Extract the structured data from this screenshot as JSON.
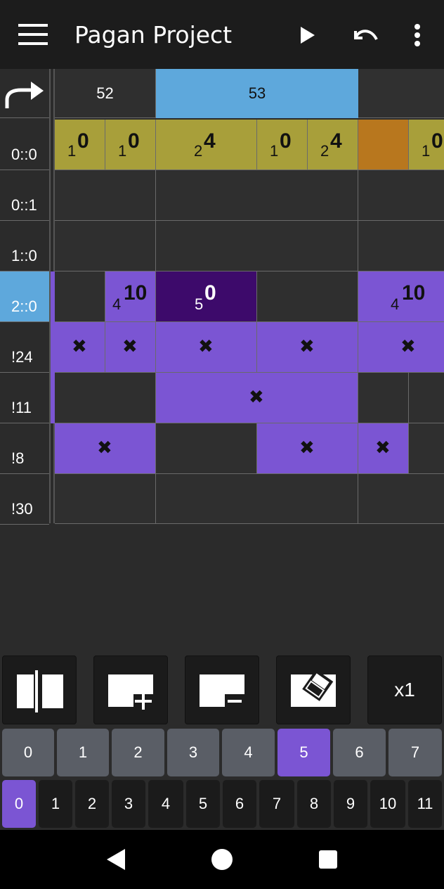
{
  "app": {
    "title": "Pagan Project",
    "menu_icon": "menu-icon",
    "play_icon": "play-icon",
    "undo_icon": "undo-icon",
    "more_icon": "more-vert-icon"
  },
  "grid": {
    "corner_icon": "redo-arrow-icon",
    "beat_headers": [
      "52",
      "53",
      ""
    ],
    "rows": [
      {
        "label": "0::0",
        "kind": "percussion-channel",
        "cells": [
          {
            "octave": "1",
            "note": "0"
          },
          {
            "octave": "1",
            "note": "0"
          },
          {
            "octave": "2",
            "note": "4"
          },
          {
            "octave": "1",
            "note": "0"
          },
          {
            "octave": "2",
            "note": "4"
          },
          {
            "octave": "",
            "note": ""
          },
          {
            "octave": "1",
            "note": "0"
          }
        ]
      },
      {
        "label": "0::1",
        "kind": "empty"
      },
      {
        "label": "1::0",
        "kind": "empty"
      },
      {
        "label": "2::0",
        "kind": "selected",
        "cells": [
          {
            "octave": "",
            "note": ""
          },
          {
            "octave": "4",
            "note": "10"
          },
          {
            "octave": "5",
            "note": "0"
          },
          {
            "octave": "",
            "note": ""
          },
          {
            "octave": "4",
            "note": "10"
          }
        ]
      },
      {
        "label": "!24",
        "kind": "control"
      },
      {
        "label": "!11",
        "kind": "control"
      },
      {
        "label": "!8",
        "kind": "control"
      },
      {
        "label": "!30",
        "kind": "control"
      }
    ]
  },
  "toolbar": {
    "split_icon": "split-column-icon",
    "insert_icon": "insert-beat-icon",
    "remove_icon": "remove-beat-icon",
    "erase_icon": "eraser-icon",
    "repeat_label": "x1"
  },
  "octave_keys": [
    "0",
    "1",
    "2",
    "3",
    "4",
    "5",
    "6",
    "7"
  ],
  "octave_selected": "5",
  "note_keys": [
    "0",
    "1",
    "2",
    "3",
    "4",
    "5",
    "6",
    "7",
    "8",
    "9",
    "10",
    "11"
  ],
  "note_selected": "0",
  "nav": {
    "back_icon": "nav-back-icon",
    "home_icon": "nav-home-icon",
    "recents_icon": "nav-recents-icon"
  },
  "colors": {
    "olive": "#a89f3a",
    "orange": "#b8771e",
    "purple": "#7b55d3",
    "dark_purple": "#3d0a6b",
    "selected_blue": "#5ea8dc",
    "key_gray": "#5a5e66"
  }
}
